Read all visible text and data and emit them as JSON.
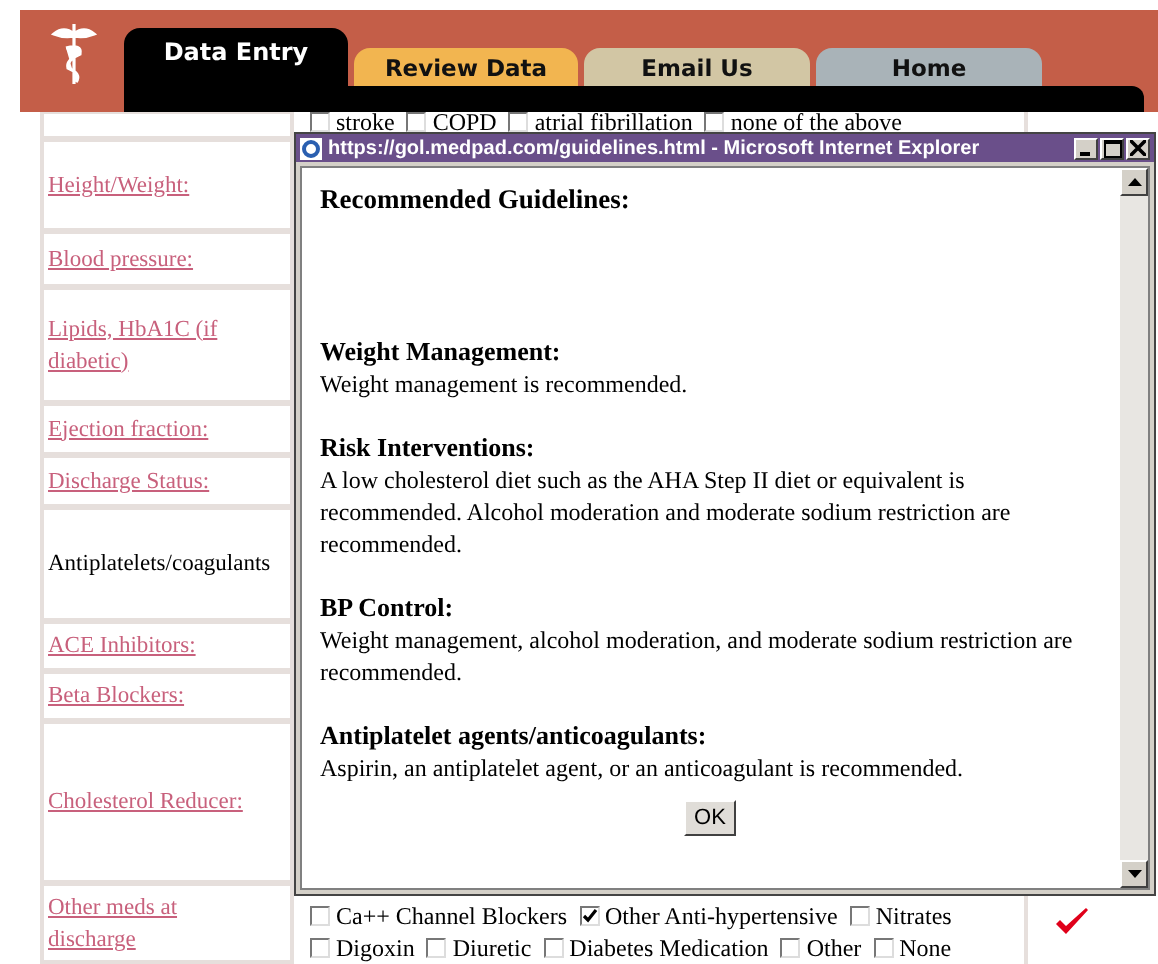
{
  "tabs": [
    {
      "label": "Data Entry",
      "selected": true,
      "color": "#000000"
    },
    {
      "label": "Review Data",
      "selected": false,
      "color": "#f2b550"
    },
    {
      "label": "Email Us",
      "selected": false,
      "color": "#d2c6a4"
    },
    {
      "label": "Home",
      "selected": false,
      "color": "#a9b3b8"
    }
  ],
  "top_options": [
    {
      "label": "stroke",
      "checked": false
    },
    {
      "label": "COPD",
      "checked": false
    },
    {
      "label": "atrial fibrillation",
      "checked": false
    },
    {
      "label": "none of the above",
      "checked": false
    }
  ],
  "fields": [
    {
      "label": "Height/Weight:",
      "kind": "link"
    },
    {
      "label": "Blood pressure:",
      "kind": "link"
    },
    {
      "label": "Lipids, HbA1C (if diabetic)",
      "kind": "link"
    },
    {
      "label": "Ejection fraction:",
      "kind": "link"
    },
    {
      "label": "Discharge Status:",
      "kind": "link"
    },
    {
      "label": "Antiplatelets/coagulants",
      "kind": "plain"
    },
    {
      "label": "ACE Inhibitors:",
      "kind": "link"
    },
    {
      "label": "Beta Blockers:",
      "kind": "link"
    },
    {
      "label": "Cholesterol Reducer:",
      "kind": "link"
    },
    {
      "label": "Other meds at discharge",
      "kind": "link"
    }
  ],
  "other_meds": [
    [
      {
        "label": "Ca++ Channel Blockers",
        "checked": false
      },
      {
        "label": "Other Anti-hypertensive",
        "checked": true
      },
      {
        "label": "Nitrates",
        "checked": false
      }
    ],
    [
      {
        "label": "Digoxin",
        "checked": false
      },
      {
        "label": "Diuretic",
        "checked": false
      },
      {
        "label": "Diabetes Medication",
        "checked": false
      },
      {
        "label": "Other",
        "checked": false
      },
      {
        "label": "None",
        "checked": false
      }
    ]
  ],
  "row_done": true,
  "popup": {
    "title": "https://gol.medpad.com/guidelines.html - Microsoft Internet Explorer",
    "heading": "Recommended Guidelines:",
    "sections": [
      {
        "title": "Weight Management:",
        "text": "Weight management is recommended."
      },
      {
        "title": "Risk Interventions:",
        "text": "A low cholesterol diet such as the AHA Step II diet or equivalent is recommended.  Alcohol moderation and moderate sodium restriction are recommended."
      },
      {
        "title": "BP Control:",
        "text": "Weight management, alcohol moderation, and moderate sodium restriction are recommended."
      },
      {
        "title": "Antiplatelet agents/anticoagulants:",
        "text": "Aspirin, an antiplatelet agent, or an anticoagulant is recommended."
      }
    ],
    "button": "OK"
  }
}
